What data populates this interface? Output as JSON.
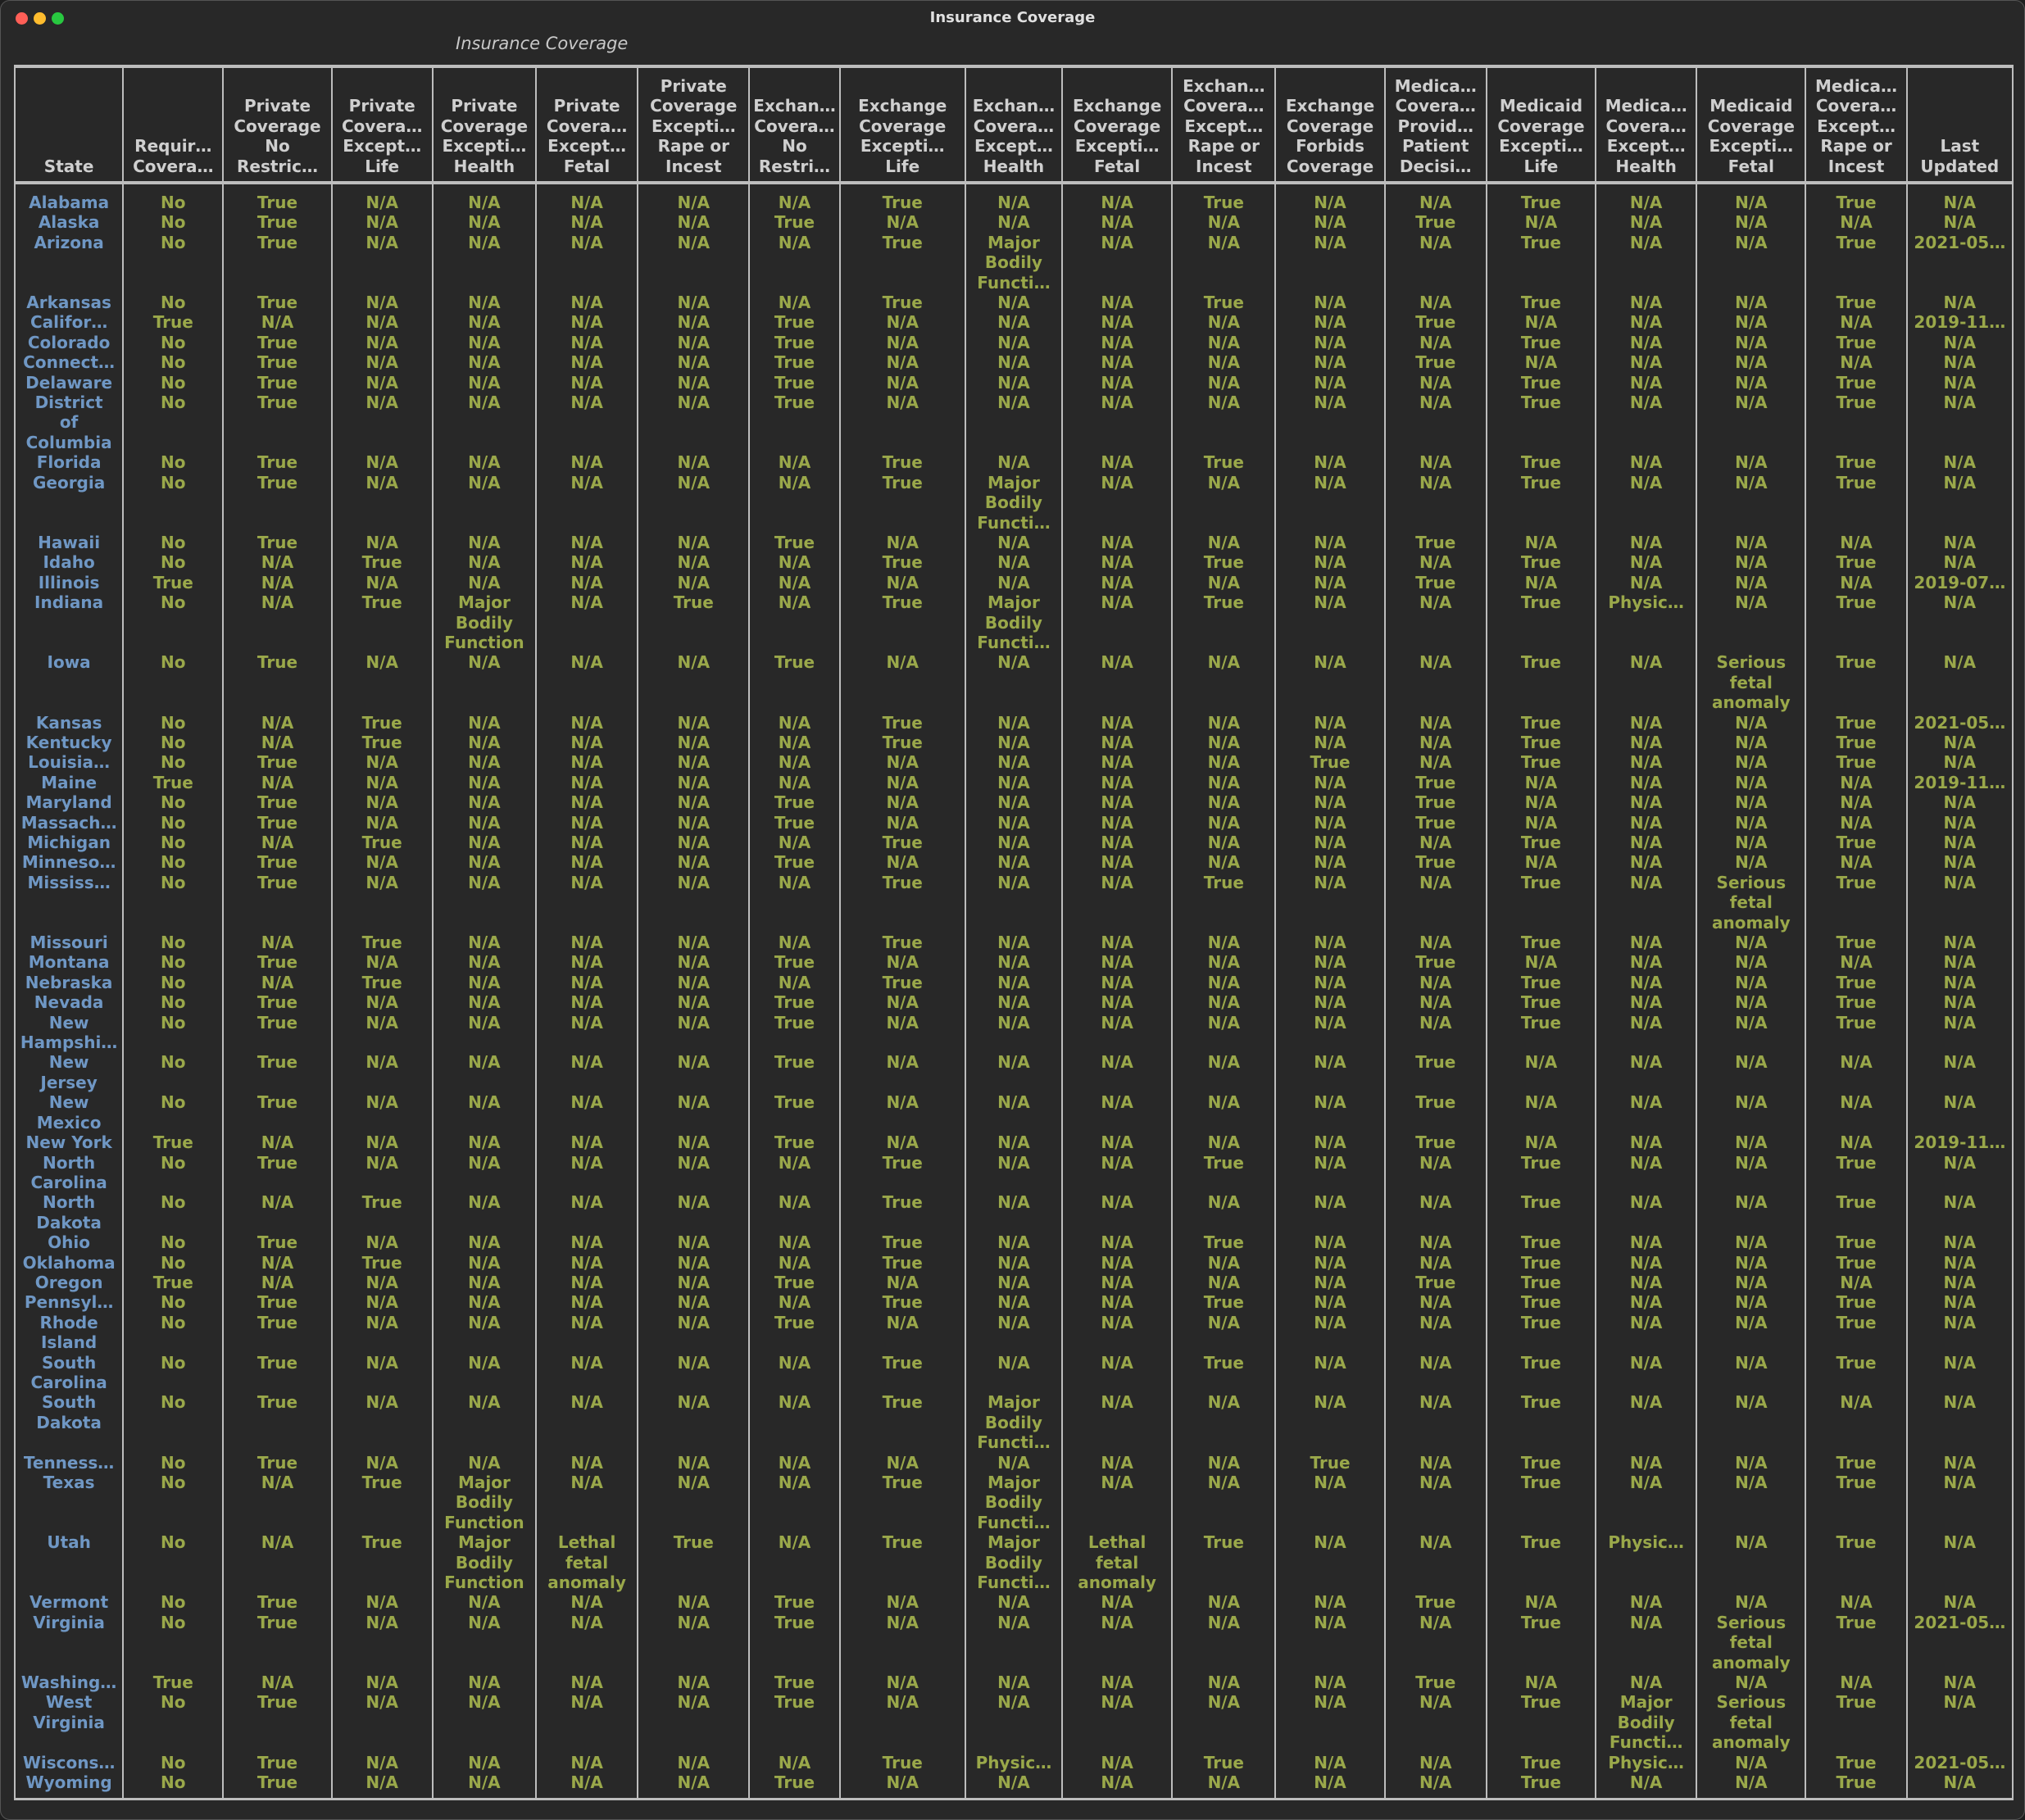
{
  "window": {
    "title": "Insurance Coverage"
  },
  "table": {
    "caption": "Insurance Coverage",
    "headers": [
      "State",
      "Requir…\nCovera…",
      "Private\nCoverage\nNo\nRestric…",
      "Private\nCovera…\nExcept…\nLife",
      "Private\nCoverage\nExcepti…\nHealth",
      "Private\nCovera…\nExcept…\nFetal",
      "Private\nCoverage\nExcepti…\nRape or\nIncest",
      "Exchan…\nCovera…\nNo\nRestri…",
      "Exchange\nCoverage\nExcepti…\nLife",
      "Exchan…\nCovera…\nExcept…\nHealth",
      "Exchange\nCoverage\nExcepti…\nFetal",
      "Exchan…\nCovera…\nExcept…\nRape or\nIncest",
      "Exchange\nCoverage\nForbids\nCoverage",
      "Medica…\nCovera…\nProvid…\nPatient\nDecisi…",
      "Medicaid\nCoverage\nExcepti…\nLife",
      "Medica…\nCovera…\nExcept…\nHealth",
      "Medicaid\nCoverage\nExcepti…\nFetal",
      "Medica…\nCovera…\nExcept…\nRape or\nIncest",
      "Last\nUpdated"
    ],
    "rows": [
      [
        "Alabama",
        "No",
        "True",
        "N/A",
        "N/A",
        "N/A",
        "N/A",
        "N/A",
        "True",
        "N/A",
        "N/A",
        "True",
        "N/A",
        "N/A",
        "True",
        "N/A",
        "N/A",
        "True",
        "N/A"
      ],
      [
        "Alaska",
        "No",
        "True",
        "N/A",
        "N/A",
        "N/A",
        "N/A",
        "True",
        "N/A",
        "N/A",
        "N/A",
        "N/A",
        "N/A",
        "True",
        "N/A",
        "N/A",
        "N/A",
        "N/A",
        "N/A"
      ],
      [
        "Arizona",
        "No",
        "True",
        "N/A",
        "N/A",
        "N/A",
        "N/A",
        "N/A",
        "True",
        "Major\nBodily\nFuncti…",
        "N/A",
        "N/A",
        "N/A",
        "N/A",
        "True",
        "N/A",
        "N/A",
        "True",
        "2021-05…"
      ],
      [
        "Arkansas",
        "No",
        "True",
        "N/A",
        "N/A",
        "N/A",
        "N/A",
        "N/A",
        "True",
        "N/A",
        "N/A",
        "True",
        "N/A",
        "N/A",
        "True",
        "N/A",
        "N/A",
        "True",
        "N/A"
      ],
      [
        "Califor…",
        "True",
        "N/A",
        "N/A",
        "N/A",
        "N/A",
        "N/A",
        "True",
        "N/A",
        "N/A",
        "N/A",
        "N/A",
        "N/A",
        "True",
        "N/A",
        "N/A",
        "N/A",
        "N/A",
        "2019-11…"
      ],
      [
        "Colorado",
        "No",
        "True",
        "N/A",
        "N/A",
        "N/A",
        "N/A",
        "True",
        "N/A",
        "N/A",
        "N/A",
        "N/A",
        "N/A",
        "N/A",
        "True",
        "N/A",
        "N/A",
        "True",
        "N/A"
      ],
      [
        "Connect…",
        "No",
        "True",
        "N/A",
        "N/A",
        "N/A",
        "N/A",
        "True",
        "N/A",
        "N/A",
        "N/A",
        "N/A",
        "N/A",
        "True",
        "N/A",
        "N/A",
        "N/A",
        "N/A",
        "N/A"
      ],
      [
        "Delaware",
        "No",
        "True",
        "N/A",
        "N/A",
        "N/A",
        "N/A",
        "True",
        "N/A",
        "N/A",
        "N/A",
        "N/A",
        "N/A",
        "N/A",
        "True",
        "N/A",
        "N/A",
        "True",
        "N/A"
      ],
      [
        "District\nof\nColumbia",
        "No",
        "True",
        "N/A",
        "N/A",
        "N/A",
        "N/A",
        "True",
        "N/A",
        "N/A",
        "N/A",
        "N/A",
        "N/A",
        "N/A",
        "True",
        "N/A",
        "N/A",
        "True",
        "N/A"
      ],
      [
        "Florida",
        "No",
        "True",
        "N/A",
        "N/A",
        "N/A",
        "N/A",
        "N/A",
        "True",
        "N/A",
        "N/A",
        "True",
        "N/A",
        "N/A",
        "True",
        "N/A",
        "N/A",
        "True",
        "N/A"
      ],
      [
        "Georgia",
        "No",
        "True",
        "N/A",
        "N/A",
        "N/A",
        "N/A",
        "N/A",
        "True",
        "Major\nBodily\nFuncti…",
        "N/A",
        "N/A",
        "N/A",
        "N/A",
        "True",
        "N/A",
        "N/A",
        "True",
        "N/A"
      ],
      [
        "Hawaii",
        "No",
        "True",
        "N/A",
        "N/A",
        "N/A",
        "N/A",
        "True",
        "N/A",
        "N/A",
        "N/A",
        "N/A",
        "N/A",
        "True",
        "N/A",
        "N/A",
        "N/A",
        "N/A",
        "N/A"
      ],
      [
        "Idaho",
        "No",
        "N/A",
        "True",
        "N/A",
        "N/A",
        "N/A",
        "N/A",
        "True",
        "N/A",
        "N/A",
        "True",
        "N/A",
        "N/A",
        "True",
        "N/A",
        "N/A",
        "True",
        "N/A"
      ],
      [
        "Illinois",
        "True",
        "N/A",
        "N/A",
        "N/A",
        "N/A",
        "N/A",
        "N/A",
        "N/A",
        "N/A",
        "N/A",
        "N/A",
        "N/A",
        "True",
        "N/A",
        "N/A",
        "N/A",
        "N/A",
        "2019-07…"
      ],
      [
        "Indiana",
        "No",
        "N/A",
        "True",
        "Major\nBodily\nFunction",
        "N/A",
        "True",
        "N/A",
        "True",
        "Major\nBodily\nFuncti…",
        "N/A",
        "True",
        "N/A",
        "N/A",
        "True",
        "Physic…",
        "N/A",
        "True",
        "N/A"
      ],
      [
        "Iowa",
        "No",
        "True",
        "N/A",
        "N/A",
        "N/A",
        "N/A",
        "True",
        "N/A",
        "N/A",
        "N/A",
        "N/A",
        "N/A",
        "N/A",
        "True",
        "N/A",
        "Serious\nfetal\nanomaly",
        "True",
        "N/A"
      ],
      [
        "Kansas",
        "No",
        "N/A",
        "True",
        "N/A",
        "N/A",
        "N/A",
        "N/A",
        "True",
        "N/A",
        "N/A",
        "N/A",
        "N/A",
        "N/A",
        "True",
        "N/A",
        "N/A",
        "True",
        "2021-05…"
      ],
      [
        "Kentucky",
        "No",
        "N/A",
        "True",
        "N/A",
        "N/A",
        "N/A",
        "N/A",
        "True",
        "N/A",
        "N/A",
        "N/A",
        "N/A",
        "N/A",
        "True",
        "N/A",
        "N/A",
        "True",
        "N/A"
      ],
      [
        "Louisia…",
        "No",
        "True",
        "N/A",
        "N/A",
        "N/A",
        "N/A",
        "N/A",
        "N/A",
        "N/A",
        "N/A",
        "N/A",
        "True",
        "N/A",
        "True",
        "N/A",
        "N/A",
        "True",
        "N/A"
      ],
      [
        "Maine",
        "True",
        "N/A",
        "N/A",
        "N/A",
        "N/A",
        "N/A",
        "N/A",
        "N/A",
        "N/A",
        "N/A",
        "N/A",
        "N/A",
        "True",
        "N/A",
        "N/A",
        "N/A",
        "N/A",
        "2019-11…"
      ],
      [
        "Maryland",
        "No",
        "True",
        "N/A",
        "N/A",
        "N/A",
        "N/A",
        "True",
        "N/A",
        "N/A",
        "N/A",
        "N/A",
        "N/A",
        "True",
        "N/A",
        "N/A",
        "N/A",
        "N/A",
        "N/A"
      ],
      [
        "Massach…",
        "No",
        "True",
        "N/A",
        "N/A",
        "N/A",
        "N/A",
        "True",
        "N/A",
        "N/A",
        "N/A",
        "N/A",
        "N/A",
        "True",
        "N/A",
        "N/A",
        "N/A",
        "N/A",
        "N/A"
      ],
      [
        "Michigan",
        "No",
        "N/A",
        "True",
        "N/A",
        "N/A",
        "N/A",
        "N/A",
        "True",
        "N/A",
        "N/A",
        "N/A",
        "N/A",
        "N/A",
        "True",
        "N/A",
        "N/A",
        "True",
        "N/A"
      ],
      [
        "Minneso…",
        "No",
        "True",
        "N/A",
        "N/A",
        "N/A",
        "N/A",
        "True",
        "N/A",
        "N/A",
        "N/A",
        "N/A",
        "N/A",
        "True",
        "N/A",
        "N/A",
        "N/A",
        "N/A",
        "N/A"
      ],
      [
        "Mississ…",
        "No",
        "True",
        "N/A",
        "N/A",
        "N/A",
        "N/A",
        "N/A",
        "True",
        "N/A",
        "N/A",
        "True",
        "N/A",
        "N/A",
        "True",
        "N/A",
        "Serious\nfetal\nanomaly",
        "True",
        "N/A"
      ],
      [
        "Missouri",
        "No",
        "N/A",
        "True",
        "N/A",
        "N/A",
        "N/A",
        "N/A",
        "True",
        "N/A",
        "N/A",
        "N/A",
        "N/A",
        "N/A",
        "True",
        "N/A",
        "N/A",
        "True",
        "N/A"
      ],
      [
        "Montana",
        "No",
        "True",
        "N/A",
        "N/A",
        "N/A",
        "N/A",
        "True",
        "N/A",
        "N/A",
        "N/A",
        "N/A",
        "N/A",
        "True",
        "N/A",
        "N/A",
        "N/A",
        "N/A",
        "N/A"
      ],
      [
        "Nebraska",
        "No",
        "N/A",
        "True",
        "N/A",
        "N/A",
        "N/A",
        "N/A",
        "True",
        "N/A",
        "N/A",
        "N/A",
        "N/A",
        "N/A",
        "True",
        "N/A",
        "N/A",
        "True",
        "N/A"
      ],
      [
        "Nevada",
        "No",
        "True",
        "N/A",
        "N/A",
        "N/A",
        "N/A",
        "True",
        "N/A",
        "N/A",
        "N/A",
        "N/A",
        "N/A",
        "N/A",
        "True",
        "N/A",
        "N/A",
        "True",
        "N/A"
      ],
      [
        "New\nHampshi…",
        "No",
        "True",
        "N/A",
        "N/A",
        "N/A",
        "N/A",
        "True",
        "N/A",
        "N/A",
        "N/A",
        "N/A",
        "N/A",
        "N/A",
        "True",
        "N/A",
        "N/A",
        "True",
        "N/A"
      ],
      [
        "New\nJersey",
        "No",
        "True",
        "N/A",
        "N/A",
        "N/A",
        "N/A",
        "True",
        "N/A",
        "N/A",
        "N/A",
        "N/A",
        "N/A",
        "True",
        "N/A",
        "N/A",
        "N/A",
        "N/A",
        "N/A"
      ],
      [
        "New\nMexico",
        "No",
        "True",
        "N/A",
        "N/A",
        "N/A",
        "N/A",
        "True",
        "N/A",
        "N/A",
        "N/A",
        "N/A",
        "N/A",
        "True",
        "N/A",
        "N/A",
        "N/A",
        "N/A",
        "N/A"
      ],
      [
        "New York",
        "True",
        "N/A",
        "N/A",
        "N/A",
        "N/A",
        "N/A",
        "True",
        "N/A",
        "N/A",
        "N/A",
        "N/A",
        "N/A",
        "True",
        "N/A",
        "N/A",
        "N/A",
        "N/A",
        "2019-11…"
      ],
      [
        "North\nCarolina",
        "No",
        "True",
        "N/A",
        "N/A",
        "N/A",
        "N/A",
        "N/A",
        "True",
        "N/A",
        "N/A",
        "True",
        "N/A",
        "N/A",
        "True",
        "N/A",
        "N/A",
        "True",
        "N/A"
      ],
      [
        "North\nDakota",
        "No",
        "N/A",
        "True",
        "N/A",
        "N/A",
        "N/A",
        "N/A",
        "True",
        "N/A",
        "N/A",
        "N/A",
        "N/A",
        "N/A",
        "True",
        "N/A",
        "N/A",
        "True",
        "N/A"
      ],
      [
        "Ohio",
        "No",
        "True",
        "N/A",
        "N/A",
        "N/A",
        "N/A",
        "N/A",
        "True",
        "N/A",
        "N/A",
        "True",
        "N/A",
        "N/A",
        "True",
        "N/A",
        "N/A",
        "True",
        "N/A"
      ],
      [
        "Oklahoma",
        "No",
        "N/A",
        "True",
        "N/A",
        "N/A",
        "N/A",
        "N/A",
        "True",
        "N/A",
        "N/A",
        "N/A",
        "N/A",
        "N/A",
        "True",
        "N/A",
        "N/A",
        "True",
        "N/A"
      ],
      [
        "Oregon",
        "True",
        "N/A",
        "N/A",
        "N/A",
        "N/A",
        "N/A",
        "True",
        "N/A",
        "N/A",
        "N/A",
        "N/A",
        "N/A",
        "True",
        "True",
        "N/A",
        "N/A",
        "N/A",
        "N/A"
      ],
      [
        "Pennsyl…",
        "No",
        "True",
        "N/A",
        "N/A",
        "N/A",
        "N/A",
        "N/A",
        "True",
        "N/A",
        "N/A",
        "True",
        "N/A",
        "N/A",
        "True",
        "N/A",
        "N/A",
        "True",
        "N/A"
      ],
      [
        "Rhode\nIsland",
        "No",
        "True",
        "N/A",
        "N/A",
        "N/A",
        "N/A",
        "True",
        "N/A",
        "N/A",
        "N/A",
        "N/A",
        "N/A",
        "N/A",
        "True",
        "N/A",
        "N/A",
        "True",
        "N/A"
      ],
      [
        "South\nCarolina",
        "No",
        "True",
        "N/A",
        "N/A",
        "N/A",
        "N/A",
        "N/A",
        "True",
        "N/A",
        "N/A",
        "True",
        "N/A",
        "N/A",
        "True",
        "N/A",
        "N/A",
        "True",
        "N/A"
      ],
      [
        "South\nDakota",
        "No",
        "True",
        "N/A",
        "N/A",
        "N/A",
        "N/A",
        "N/A",
        "True",
        "Major\nBodily\nFuncti…",
        "N/A",
        "N/A",
        "N/A",
        "N/A",
        "True",
        "N/A",
        "N/A",
        "N/A",
        "N/A"
      ],
      [
        "Tenness…",
        "No",
        "True",
        "N/A",
        "N/A",
        "N/A",
        "N/A",
        "N/A",
        "N/A",
        "N/A",
        "N/A",
        "N/A",
        "True",
        "N/A",
        "True",
        "N/A",
        "N/A",
        "True",
        "N/A"
      ],
      [
        "Texas",
        "No",
        "N/A",
        "True",
        "Major\nBodily\nFunction",
        "N/A",
        "N/A",
        "N/A",
        "True",
        "Major\nBodily\nFuncti…",
        "N/A",
        "N/A",
        "N/A",
        "N/A",
        "True",
        "N/A",
        "N/A",
        "True",
        "N/A"
      ],
      [
        "Utah",
        "No",
        "N/A",
        "True",
        "Major\nBodily\nFunction",
        "Lethal\nfetal\nanomaly",
        "True",
        "N/A",
        "True",
        "Major\nBodily\nFuncti…",
        "Lethal\nfetal\nanomaly",
        "True",
        "N/A",
        "N/A",
        "True",
        "Physic…",
        "N/A",
        "True",
        "N/A"
      ],
      [
        "Vermont",
        "No",
        "True",
        "N/A",
        "N/A",
        "N/A",
        "N/A",
        "True",
        "N/A",
        "N/A",
        "N/A",
        "N/A",
        "N/A",
        "True",
        "N/A",
        "N/A",
        "N/A",
        "N/A",
        "N/A"
      ],
      [
        "Virginia",
        "No",
        "True",
        "N/A",
        "N/A",
        "N/A",
        "N/A",
        "True",
        "N/A",
        "N/A",
        "N/A",
        "N/A",
        "N/A",
        "N/A",
        "True",
        "N/A",
        "Serious\nfetal\nanomaly",
        "True",
        "2021-05…"
      ],
      [
        "Washing…",
        "True",
        "N/A",
        "N/A",
        "N/A",
        "N/A",
        "N/A",
        "True",
        "N/A",
        "N/A",
        "N/A",
        "N/A",
        "N/A",
        "True",
        "N/A",
        "N/A",
        "N/A",
        "N/A",
        "N/A"
      ],
      [
        "West\nVirginia",
        "No",
        "True",
        "N/A",
        "N/A",
        "N/A",
        "N/A",
        "True",
        "N/A",
        "N/A",
        "N/A",
        "N/A",
        "N/A",
        "N/A",
        "True",
        "Major\nBodily\nFuncti…",
        "Serious\nfetal\nanomaly",
        "True",
        "N/A"
      ],
      [
        "Wiscons…",
        "No",
        "True",
        "N/A",
        "N/A",
        "N/A",
        "N/A",
        "N/A",
        "True",
        "Physic…",
        "N/A",
        "True",
        "N/A",
        "N/A",
        "True",
        "Physic…",
        "N/A",
        "True",
        "2021-05…"
      ],
      [
        "Wyoming",
        "No",
        "True",
        "N/A",
        "N/A",
        "N/A",
        "N/A",
        "True",
        "N/A",
        "N/A",
        "N/A",
        "N/A",
        "N/A",
        "N/A",
        "True",
        "N/A",
        "N/A",
        "True",
        "N/A"
      ]
    ]
  },
  "colors": {
    "background": "#282828",
    "state_text": "#6f97c4",
    "value_text": "#9aa84a",
    "header_text": "#cfcfcf"
  }
}
